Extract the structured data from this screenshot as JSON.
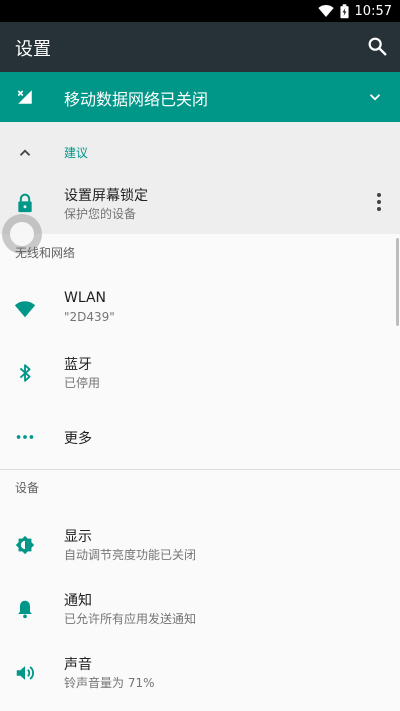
{
  "status_bar": {
    "time": "10:57",
    "icons": [
      "wifi-icon",
      "battery-icon"
    ]
  },
  "app_bar": {
    "title": "设置",
    "search_icon": "search-icon"
  },
  "banner": {
    "title": "移动数据网络已关闭",
    "icon": "mobile-data-off-icon",
    "expand_icon": "chevron-down-icon",
    "color": "#009688"
  },
  "suggestion": {
    "header": "建议",
    "item": {
      "title": "设置屏幕锁定",
      "subtitle": "保护您的设备",
      "icon": "lock-icon"
    },
    "menu_icon": "more-vert-icon"
  },
  "sections": [
    {
      "header": "无线和网络",
      "items": [
        {
          "title": "WLAN",
          "subtitle": "\"2D439\"",
          "icon": "wifi-icon"
        },
        {
          "title": "蓝牙",
          "subtitle": "已停用",
          "icon": "bluetooth-icon"
        },
        {
          "title": "更多",
          "subtitle": "",
          "icon": "more-horiz-icon"
        }
      ]
    },
    {
      "header": "设备",
      "items": [
        {
          "title": "显示",
          "subtitle": "自动调节亮度功能已关闭",
          "icon": "brightness-icon"
        },
        {
          "title": "通知",
          "subtitle": "已允许所有应用发送通知",
          "icon": "bell-icon"
        },
        {
          "title": "声音",
          "subtitle": "铃声音量为 71%",
          "icon": "volume-icon"
        }
      ]
    }
  ],
  "colors": {
    "accent": "#009688",
    "toolbar": "#263238",
    "icon": "#009688"
  }
}
